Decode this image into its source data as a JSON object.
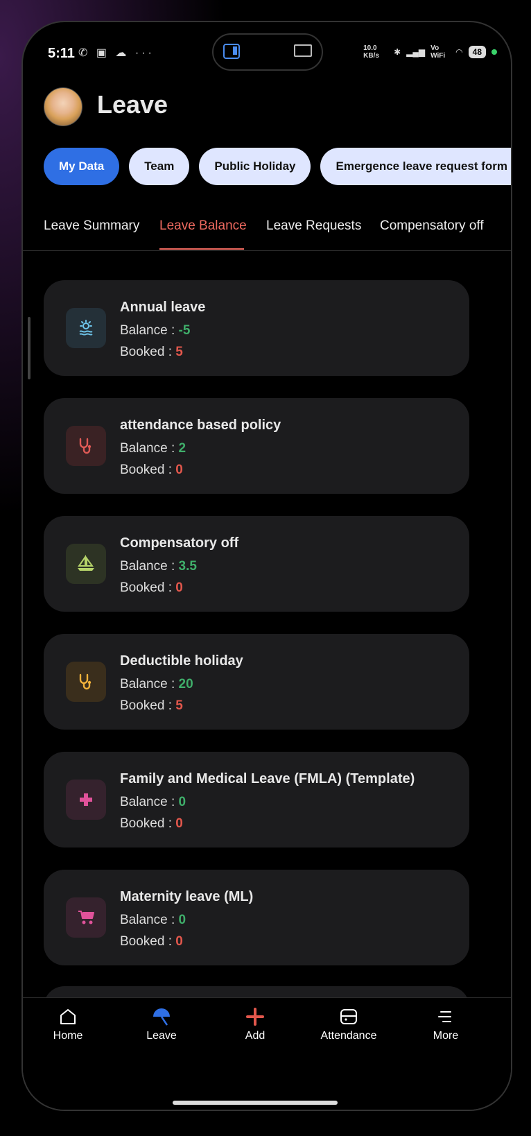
{
  "status": {
    "time": "5:11",
    "left_icons": "✆ ▣ ☁ ···",
    "speed": "10.0 KB/s",
    "network": "Vo WiFi",
    "battery": "48"
  },
  "header": {
    "title": "Leave"
  },
  "chips": [
    "My Data",
    "Team",
    "Public Holiday",
    "Emergence leave request form"
  ],
  "tabs": [
    "Leave Summary",
    "Leave Balance",
    "Leave Requests",
    "Compensatory off"
  ],
  "labels": {
    "balance": "Balance : ",
    "booked": "Booked : "
  },
  "cards": [
    {
      "title": "Annual leave",
      "balance": "-5",
      "booked": "5",
      "icon": "sun-wave-icon",
      "icon_bg": "#243038",
      "icon_color": "#6ec3e8"
    },
    {
      "title": "attendance based policy",
      "balance": "2",
      "booked": "0",
      "icon": "stethoscope-icon",
      "icon_bg": "#3a2224",
      "icon_color": "#e05a56"
    },
    {
      "title": "Compensatory off",
      "balance": "3.5",
      "booked": "0",
      "icon": "boat-icon",
      "icon_bg": "#2d3324",
      "icon_color": "#b6d46a"
    },
    {
      "title": "Deductible holiday",
      "balance": "20",
      "booked": "5",
      "icon": "stethoscope-icon",
      "icon_bg": "#3a2e1c",
      "icon_color": "#f2b23a"
    },
    {
      "title": "Family and Medical Leave (FMLA) (Template)",
      "balance": "0",
      "booked": "0",
      "icon": "medical-cross-icon",
      "icon_bg": "#35222d",
      "icon_color": "#e0529a"
    },
    {
      "title": "Maternity leave (ML)",
      "balance": "0",
      "booked": "0",
      "icon": "stroller-icon",
      "icon_bg": "#35222d",
      "icon_color": "#e0529a"
    }
  ],
  "nav": [
    "Home",
    "Leave",
    "Add",
    "Attendance",
    "More"
  ],
  "colors": {
    "accent": "#2f6fe4",
    "tab_active": "#f06a60",
    "balance": "#3fae6a",
    "booked": "#e2574c"
  }
}
